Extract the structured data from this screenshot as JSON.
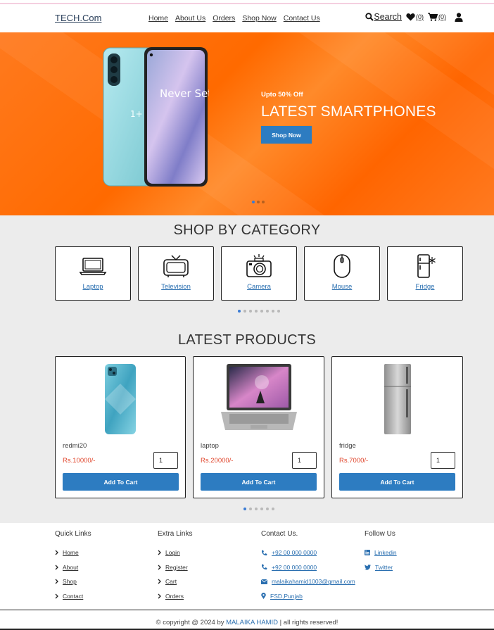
{
  "header": {
    "brand": "TECH.Com",
    "nav": [
      "Home",
      "About Us",
      "Orders",
      "Shop Now",
      "Contact Us"
    ],
    "search_label": "Search",
    "wishlist_count": "(0)",
    "cart_count": "(0)"
  },
  "hero": {
    "tagline": "Upto 50% Off",
    "title": "LATEST SMARTPHONES",
    "button": "Shop Now",
    "phone_text": "Never Settle",
    "slides": 3,
    "active_slide": 0
  },
  "categories": {
    "title": "SHOP BY CATEGORY",
    "items": [
      {
        "label": "Laptop",
        "icon": "laptop-icon"
      },
      {
        "label": "Television",
        "icon": "television-icon"
      },
      {
        "label": "Camera",
        "icon": "camera-icon"
      },
      {
        "label": "Mouse",
        "icon": "mouse-icon"
      },
      {
        "label": "Fridge",
        "icon": "fridge-icon"
      }
    ],
    "pages": 8,
    "active_page": 0
  },
  "products": {
    "title": "LATEST PRODUCTS",
    "items": [
      {
        "name": "redmi20",
        "price": "Rs.10000/-",
        "qty": "1",
        "button": "Add To Cart"
      },
      {
        "name": "laptop",
        "price": "Rs.20000/-",
        "qty": "1",
        "button": "Add To Cart"
      },
      {
        "name": "fridge",
        "price": "Rs.7000/-",
        "qty": "1",
        "button": "Add To Cart"
      }
    ],
    "pages": 6,
    "active_page": 0
  },
  "footer": {
    "quick_links": {
      "title": "Quick Links",
      "items": [
        "Home",
        "About",
        "Shop",
        "Contact"
      ]
    },
    "extra_links": {
      "title": "Extra Links",
      "items": [
        "Login",
        "Register",
        "Cart",
        "Orders"
      ]
    },
    "contact": {
      "title": "Contact Us.",
      "items": [
        "+92 00 000 0000",
        "+92 00 000 0000",
        "malaikahamid1003@gmail.com",
        "FSD,Punjab"
      ]
    },
    "follow": {
      "title": "Follow Us",
      "items": [
        "Linkedin",
        "Twitter"
      ]
    },
    "copyright_pre": "© copyright @ 2024 by ",
    "copyright_name": "MALAIKA HAMID",
    "copyright_post": " | all rights reserved!"
  },
  "colors": {
    "accent": "#2d7cc1",
    "price": "#e0452b",
    "hero": "#ff6a00"
  }
}
